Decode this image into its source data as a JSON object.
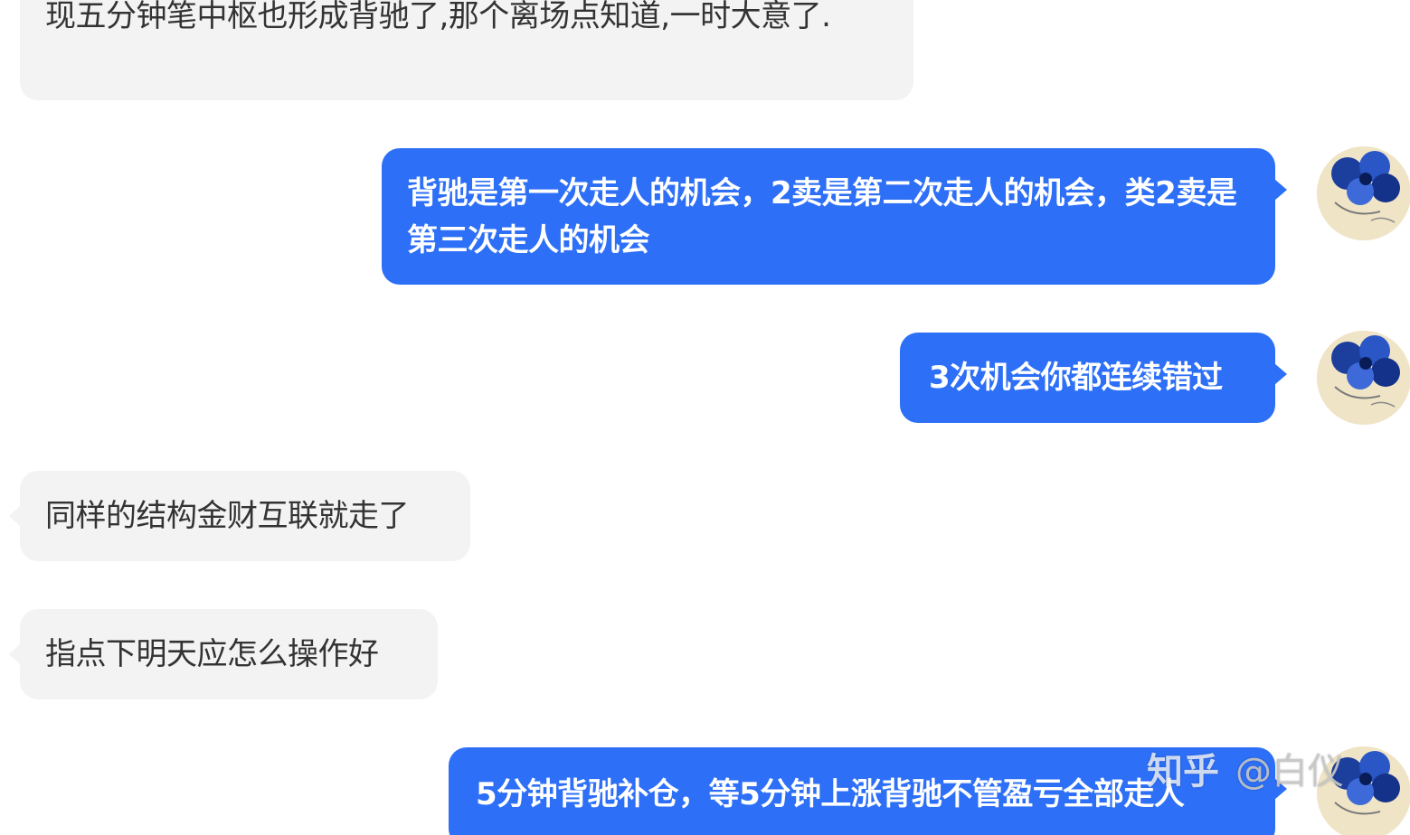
{
  "messages": [
    {
      "sender": "other",
      "text": "现五分钟笔中枢也形成背驰了,那个离场点知道,一时大意了."
    },
    {
      "sender": "self",
      "text": "背驰是第一次走人的机会，2卖是第二次走人的机会，类2卖是第三次走人的机会"
    },
    {
      "sender": "self",
      "text": "3次机会你都连续错过"
    },
    {
      "sender": "other",
      "text": "同样的结构金财互联就走了"
    },
    {
      "sender": "other",
      "text": "指点下明天应怎么操作好"
    },
    {
      "sender": "self",
      "text": "5分钟背驰补仓，等5分钟上涨背驰不管盈亏全部走人"
    }
  ],
  "watermark": {
    "site": "知乎",
    "handle": "@白仪"
  },
  "avatar": {
    "icon": "blue-flower-avatar"
  },
  "colors": {
    "outgoing_bubble": "#2d6ff7",
    "incoming_bubble": "#f3f3f3",
    "incoming_text": "#333333",
    "outgoing_text": "#ffffff"
  }
}
